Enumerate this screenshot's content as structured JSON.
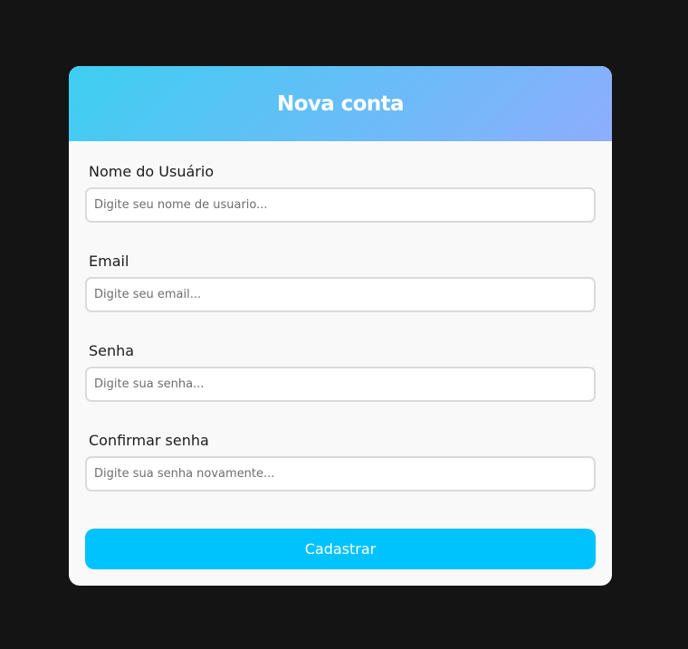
{
  "form": {
    "title": "Nova conta",
    "fields": [
      {
        "label": "Nome do Usuário",
        "placeholder": "Digite seu nome de usuario...",
        "value": ""
      },
      {
        "label": "Email",
        "placeholder": "Digite seu email...",
        "value": ""
      },
      {
        "label": "Senha",
        "placeholder": "Digite sua senha...",
        "value": ""
      },
      {
        "label": "Confirmar senha",
        "placeholder": "Digite sua senha novamente...",
        "value": ""
      }
    ],
    "submit_label": "Cadastrar"
  },
  "colors": {
    "background": "#141414",
    "card": "#f9f9f9",
    "header_gradient_start": "#3dcff1",
    "header_gradient_end": "#8eadfd",
    "button": "#00c3fe"
  }
}
